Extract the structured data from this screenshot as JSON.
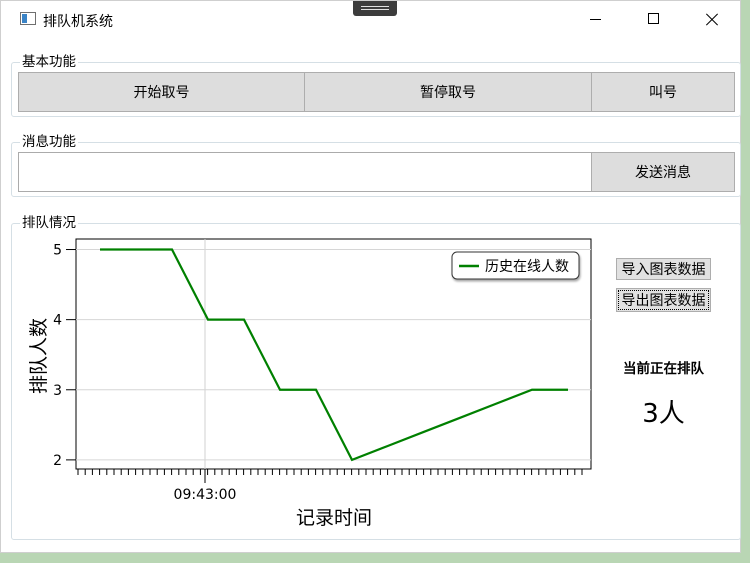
{
  "window": {
    "title": "排队机系统",
    "controls": [
      "minimize",
      "maximize",
      "close"
    ]
  },
  "basic": {
    "title": "基本功能",
    "buttons": {
      "start": "开始取号",
      "pause": "暂停取号",
      "call": "叫号"
    }
  },
  "message": {
    "title": "消息功能",
    "input_value": "",
    "send": "发送消息"
  },
  "queue": {
    "title": "排队情况",
    "import_btn": "导入图表数据",
    "export_btn": "导出图表数据",
    "current_label": "当前正在排队",
    "current_count": "3人"
  },
  "chart_data": {
    "type": "line",
    "xlabel": "记录时间",
    "ylabel": "排队人数",
    "x_tick_labels": [
      "09:43:00"
    ],
    "y_ticks": [
      2,
      3,
      4,
      5
    ],
    "ylim": [
      1.87,
      5.15
    ],
    "legend_position": "top-right",
    "grid": true,
    "series": [
      {
        "name": "历史在线人数",
        "color": "#008000",
        "values": [
          5,
          5,
          5,
          4,
          4,
          3,
          3,
          2,
          2.2,
          2.4,
          2.6,
          2.8,
          3,
          3
        ]
      }
    ]
  }
}
